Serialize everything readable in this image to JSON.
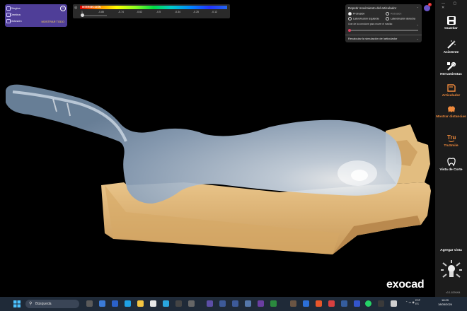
{
  "layers": {
    "items": [
      {
        "label": "Gingiva"
      },
      {
        "label": "Dentina"
      },
      {
        "label": "Oclusión"
      }
    ],
    "show_all": "MOSTRAR TODO",
    "help_glyph": "?"
  },
  "intersection_bar": {
    "label": "INTERSECCIÓN",
    "ticks": [
      "1",
      "-0.85",
      "-0.74",
      "-0.62",
      "-0.5",
      "-0.34",
      "-0.25",
      "-0.12"
    ]
  },
  "articulator": {
    "title": "Repetir movimiento del articulador",
    "options": [
      {
        "label": "Protrusión",
        "selected": true
      },
      {
        "label": "Retrusión",
        "selected": false
      },
      {
        "label": "Laterotrusión izquierda",
        "selected": false
      },
      {
        "label": "Laterotrusión derecha",
        "selected": false
      }
    ],
    "slider_label": "Grar de la corncione para mover el maxilar.",
    "recalc": "Recalcular la simulación del articulador"
  },
  "sidebar": {
    "items": [
      {
        "label": "Guardar",
        "icon": "save-icon"
      },
      {
        "label": "Asistente",
        "icon": "wand-icon"
      },
      {
        "label": "Herramientas",
        "icon": "tools-icon"
      },
      {
        "label": "Articulador",
        "icon": "articulator-icon"
      },
      {
        "label": "Mostrar distancias",
        "icon": "distance-icon"
      },
      {
        "label": "TruSmile",
        "icon": "trusmile-icon"
      },
      {
        "label": "Vista de Corte",
        "icon": "tooth-section-icon"
      }
    ],
    "add_view": "Agregar vista",
    "version": "v3.1-8290/64"
  },
  "brand": "exocad",
  "notification_count": "1",
  "taskbar": {
    "search_placeholder": "Búsqueda",
    "tray": "ESP\nES",
    "time": "18:29",
    "date": "18/05/2024"
  },
  "colors": {
    "model_stone": "#e0b677",
    "wax_blue": "#8fa4bb",
    "panel_purple": "#4f3e98",
    "accent_orange": "#f08a3c"
  }
}
